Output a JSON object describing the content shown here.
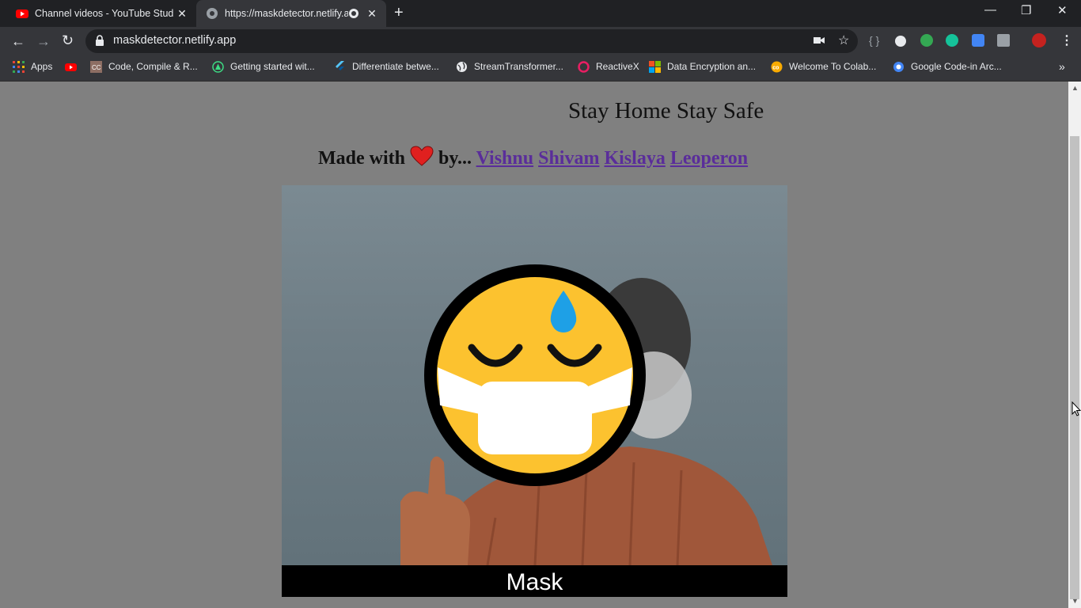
{
  "tabs": [
    {
      "title": "Channel videos - YouTube Studio",
      "active": false,
      "favicon": "youtube-icon"
    },
    {
      "title": "https://maskdetector.netlify.app",
      "active": true,
      "favicon": "globe-icon"
    }
  ],
  "address_bar": {
    "url": "maskdetector.netlify.app"
  },
  "bookmarks": [
    {
      "label": "Apps",
      "icon": "apps-grid-icon"
    },
    {
      "label": "",
      "icon": "youtube-icon"
    },
    {
      "label": "Code, Compile & R...",
      "icon": "cc-icon"
    },
    {
      "label": "Getting started wit...",
      "icon": "android-icon"
    },
    {
      "label": "Differentiate betwe...",
      "icon": "flutter-icon"
    },
    {
      "label": "StreamTransformer...",
      "icon": "globe-icon"
    },
    {
      "label": "ReactiveX",
      "icon": "reactivex-icon"
    },
    {
      "label": "Data Encryption an...",
      "icon": "microsoft-icon"
    },
    {
      "label": "Welcome To Colab...",
      "icon": "colab-icon"
    },
    {
      "label": "Google Code-in Arc...",
      "icon": "gci-icon"
    }
  ],
  "page": {
    "heading": "Stay Home Stay Safe",
    "made_with": "Made with",
    "by": "by...",
    "authors": [
      "Vishnu",
      "Shivam",
      "Kislaya",
      "Leoperon"
    ],
    "video_label": "Mask"
  },
  "colors": {
    "accent": "#5a2d9a",
    "page_bg": "#808080",
    "chrome_dark": "#202124",
    "chrome_toolbar": "#35363a"
  }
}
